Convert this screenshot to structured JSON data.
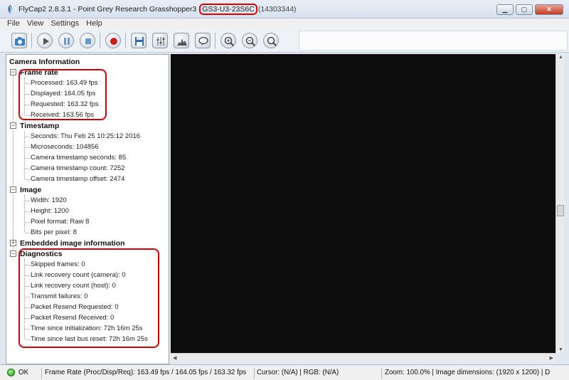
{
  "window": {
    "title_prefix": "FlyCap2 2.8.3.1 - Point Grey Research Grasshopper3 ",
    "title_model": "GS3-U3-23S6C",
    "title_serial": "(14303344)",
    "buttons": {
      "minimize": "▁",
      "maximize": "▢",
      "close": "✕"
    }
  },
  "menu": [
    "File",
    "View",
    "Settings",
    "Help"
  ],
  "toolbar": {
    "buttons": [
      "camera-select",
      "start",
      "pause",
      "stop",
      "record",
      "save",
      "settings",
      "histogram",
      "event-stats",
      "zoom-in",
      "zoom-out",
      "zoom-100"
    ]
  },
  "tree": {
    "root": "Camera Information",
    "groups": [
      {
        "label": "Frame rate",
        "items": [
          "Processed: 163.49 fps",
          "Displayed: 164.05 fps",
          "Requested: 163.32 fps",
          "Received: 163.56 fps"
        ]
      },
      {
        "label": "Timestamp",
        "items": [
          "Seconds: Thu Feb 25 10:25:12 2016",
          "Microseconds: 104856",
          "Camera timestamp seconds: 85",
          "Camera timestamp count:  7252",
          "Camera timestamp offset: 2474"
        ]
      },
      {
        "label": "Image",
        "items": [
          "Width: 1920",
          "Height: 1200",
          "Pixel format: Raw 8",
          "Bits per pixel:  8"
        ]
      },
      {
        "label": "Embedded image information",
        "items": []
      },
      {
        "label": "Diagnostics",
        "items": [
          "Skipped frames: 0",
          "Link recovery count (camera): 0",
          "Link recovery count (host): 0",
          "Transmit failures: 0",
          "Packet Resend Requested: 0",
          "Packet Resend Received: 0",
          "Time since initialization: 72h 16m 25s",
          "Time since last bus reset: 72h 16m 25s"
        ]
      }
    ]
  },
  "status": {
    "ok": "OK",
    "framerate": "Frame Rate (Proc/Disp/Req): 163.49 fps / 164.05 fps / 163.32 fps",
    "cursor": "Cursor: (N/A) | RGB: (N/A)",
    "zoom": "Zoom: 100.0% | Image dimensions: (1920 x 1200) | D"
  },
  "colors": {
    "highlight": "#d40000",
    "image_bg": "#0d0d0e",
    "status_ok": "#1a9b16"
  }
}
